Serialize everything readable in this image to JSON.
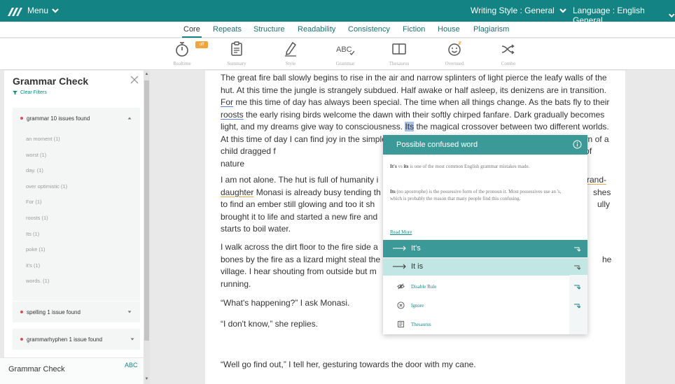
{
  "topbar": {
    "menu_label": "Menu",
    "writing_style": "Writing Style : General",
    "language": "Language : English General"
  },
  "tabs": [
    "Core",
    "Repeats",
    "Structure",
    "Readability",
    "Consistency",
    "Fiction",
    "House",
    "Plagiarism"
  ],
  "active_tab": "Core",
  "tools": [
    "Realtime",
    "Summary",
    "Style",
    "Grammar",
    "Thesaurus",
    "Overused",
    "Combo"
  ],
  "tools_badge": "off",
  "grammar_tool_glyph": "ABC",
  "sidebar": {
    "title": "Grammar Check",
    "clear_filters": "Clear Filters",
    "groups": [
      {
        "label": "grammar 10 issues found",
        "expanded": true,
        "items": [
          "an moment (1)",
          "worst (1)",
          "day. (1)",
          "over optimistic (1)",
          "For (1)",
          "roosts (1)",
          "Its (1)",
          "poke (1)",
          "it's (1)",
          "words. (1)"
        ]
      },
      {
        "label": "spelling 1 issue found",
        "expanded": false
      },
      {
        "label": "grammarhyphen 1 issue found",
        "expanded": false
      }
    ],
    "footer_title": "Grammar Check",
    "footer_abc": "ABC"
  },
  "document": {
    "p1": {
      "a": "The great fire ball slowly begins to rise in the air and narrow splinters of light pierce the leafy walls of the hut. At this time the jungle is strangely subdued. Half awake or half asleep, its denizens are in transition. ",
      "for": "For",
      "b": " me this time of day has always been special. The time when all things change. As the bats fly to their ",
      "roosts": "roosts",
      "c": " the early rising birds welcome the dawn with their softly chirped fanfare. Dark gradually becomes light, and my dreams give way to consciousness. ",
      "its": "Its",
      "d": " the magical crossover between two different worlds. At this time of day I can find joy in the simplest things: the sun's reflection in a drop of dew; the yawn of a child dragged f",
      "e": " tree. All around me I find the wonders of nature"
    },
    "p2": {
      "a": "I am not alone. The hut is full of humanity i",
      "grand": "rand-",
      "daughter": "daughter",
      "b": " Monasi is already busy tending th",
      "b2": "shes",
      "c": "to find an ember still glowing and too it sh",
      "c2": "ully",
      "d": "brought it to life and started a new fire and",
      "e": "starts to boil water."
    },
    "p3": {
      "a": "I walk across the dirt floor to the fire side a",
      "b": "bones by the fire as a lizard might steal the",
      "b2": "he",
      "c": "village. I hear shouting from outside but m",
      "d": "running."
    },
    "p4": "“What's happening?” I ask Monasi.",
    "p5": "“I don't know,” she replies.",
    "p6": "“Well go find out,” I tell her, gesturing towards the door with my cane."
  },
  "popup": {
    "title": "Possible confused word",
    "line1_bold_a": "It's",
    "line1_mid": " vs ",
    "line1_bold_b": "its",
    "line1_rest": " is one of the most common English grammar mistakes made.",
    "line2_bold": "Its",
    "line2_rest": " (no apostrophe) is the possessive form of the pronoun it. Most possessives use an 's, which is probably the reason that many people find this confusing.",
    "read_more": "Read More",
    "suggestions": [
      "It's",
      "It is"
    ],
    "options": [
      "Disable Rule",
      "Ignore",
      "Thesaurus"
    ]
  },
  "colors": {
    "brand": "#148383",
    "popup_header": "#3b9a98",
    "suggestion_selected": "#3b9a98",
    "suggestion_alt": "#c2e6e4",
    "issue_dot": "#d55050",
    "badge": "#f2a33a"
  },
  "icons": {
    "logo": "quill-logo-icon",
    "realtime": "stopwatch-icon",
    "summary": "clipboard-icon",
    "style": "pen-icon",
    "thesaurus": "book-icon",
    "overused": "smiley-icon",
    "combo": "shuffle-icon"
  }
}
